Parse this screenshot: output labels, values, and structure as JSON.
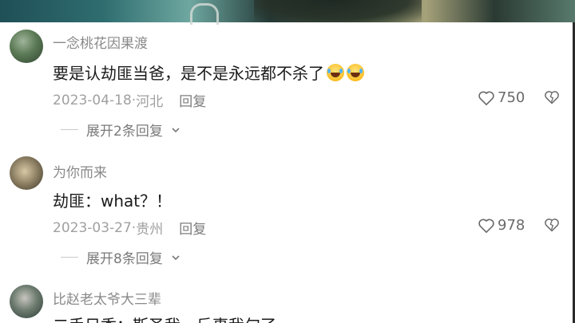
{
  "comments": [
    {
      "username": "一念桃花因果渡",
      "text": "要是认劫匪当爸，是不是永远都不杀了",
      "emojis": [
        "laugh-cry-emoji",
        "laugh-cry-emoji"
      ],
      "date": "2023-04-18",
      "location": "河北",
      "reply_label": "回复",
      "likes": "750",
      "expand_label": "展开2条回复"
    },
    {
      "username": "为你而来",
      "text": "劫匪：what？！",
      "date": "2023-03-27",
      "location": "贵州",
      "reply_label": "回复",
      "likes": "978",
      "expand_label": "展开8条回复"
    },
    {
      "username": "比赵老太爷大三辈",
      "text": "二手日香：斯圣我，斤事我句了"
    }
  ],
  "meta_separator": " · ",
  "colors": {
    "text": "#1b1b1b",
    "username": "#8a8a8a",
    "meta": "#a0a0a0"
  }
}
